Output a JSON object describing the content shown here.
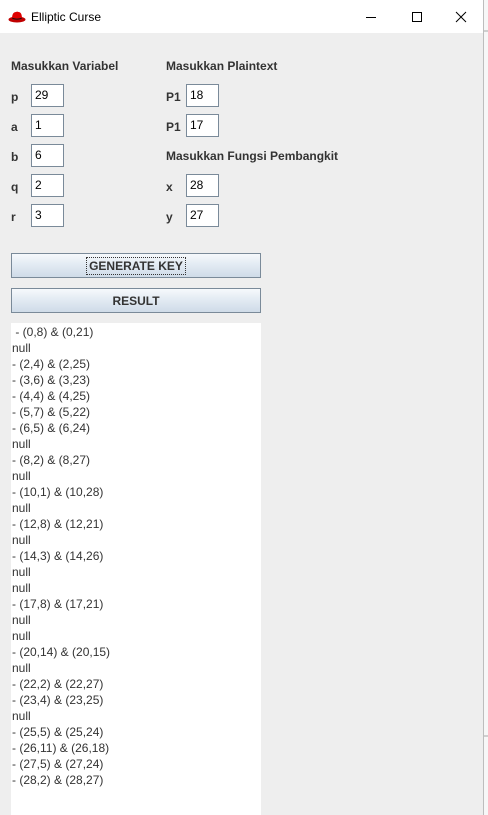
{
  "window": {
    "title": "Elliptic Curse"
  },
  "variables": {
    "heading": "Masukkan Variabel",
    "fields": [
      {
        "label": "p",
        "value": "29"
      },
      {
        "label": "a",
        "value": "1"
      },
      {
        "label": "b",
        "value": "6"
      },
      {
        "label": "q",
        "value": "2"
      },
      {
        "label": "r",
        "value": "3"
      }
    ]
  },
  "plaintext": {
    "heading": "Masukkan Plaintext",
    "fields": [
      {
        "label": "P1",
        "value": "18"
      },
      {
        "label": "P1",
        "value": "17"
      }
    ]
  },
  "generator": {
    "heading": "Masukkan Fungsi Pembangkit",
    "fields": [
      {
        "label": "x",
        "value": "28"
      },
      {
        "label": "y",
        "value": "27"
      }
    ]
  },
  "buttons": {
    "generate": "GENERATE KEY",
    "result": "RESULT"
  },
  "output_lines": [
    " - (0,8) & (0,21)",
    "null",
    "- (2,4) & (2,25)",
    "- (3,6) & (3,23)",
    "- (4,4) & (4,25)",
    "- (5,7) & (5,22)",
    "- (6,5) & (6,24)",
    "null",
    "- (8,2) & (8,27)",
    "null",
    "- (10,1) & (10,28)",
    "null",
    "- (12,8) & (12,21)",
    "null",
    "- (14,3) & (14,26)",
    "null",
    "null",
    "- (17,8) & (17,21)",
    "null",
    "null",
    "- (20,14) & (20,15)",
    "null",
    "- (22,2) & (22,27)",
    "- (23,4) & (23,25)",
    "null",
    "- (25,5) & (25,24)",
    "- (26,11) & (26,18)",
    "- (27,5) & (27,24)",
    "- (28,2) & (28,27)"
  ]
}
